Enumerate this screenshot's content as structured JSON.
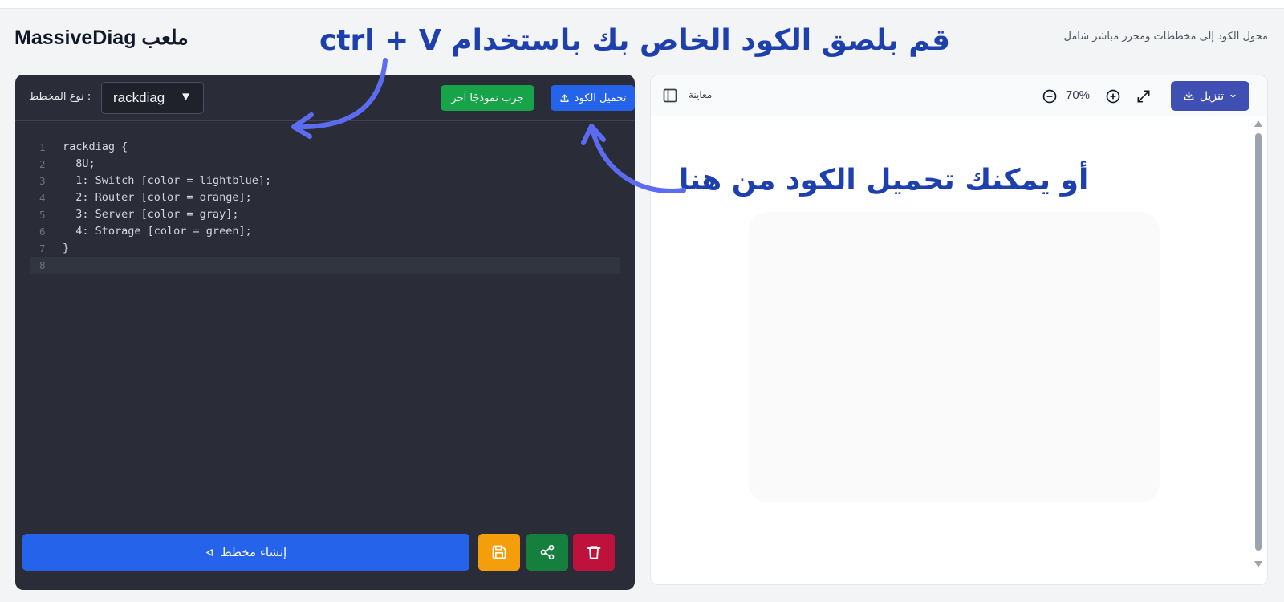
{
  "header": {
    "title": "MassiveDiag ملعب",
    "subtitle": "محول الكود إلى مخططات ومحرر مباشر شامل"
  },
  "annotations": {
    "paste_hint": "قم بلصق الكود الخاص بك باستخدام ctrl + V",
    "upload_hint": "أو يمكنك تحميل الكود من هنا"
  },
  "editor": {
    "type_label": ": نوع المخطط",
    "type_value": "rackdiag",
    "example_button": "جرب نموذجًا آخر",
    "upload_button": "تحميل الكود",
    "code_lines": [
      {
        "n": "1",
        "text": "rackdiag {"
      },
      {
        "n": "2",
        "text": "  8U;"
      },
      {
        "n": "3",
        "text": "  1: Switch [color = lightblue];"
      },
      {
        "n": "4",
        "text": "  2: Router [color = orange];"
      },
      {
        "n": "5",
        "text": "  3: Server [color = gray];"
      },
      {
        "n": "6",
        "text": "  4: Storage [color = green];"
      },
      {
        "n": "7",
        "text": "}"
      },
      {
        "n": "8",
        "text": ""
      }
    ],
    "run_button": "إنشاء مخطط"
  },
  "preview": {
    "label": "معاينة",
    "zoom": "70%",
    "download_button": "تنزيل"
  },
  "colors": {
    "annotation_text": "#1e40af",
    "annotation_arrow": "#5b6cf0",
    "primary": "#2563eb",
    "success": "#16a34a",
    "warning": "#f59e0b",
    "danger": "#be123c",
    "download": "#3f4fb4"
  },
  "icons": {
    "upload": "upload-icon",
    "save": "floppy-disk-icon",
    "share": "share-icon",
    "delete": "trash-icon",
    "run": "play-triangle-icon",
    "download": "download-icon",
    "zoom_in": "zoom-in-icon",
    "zoom_out": "zoom-out-icon",
    "fullscreen": "expand-icon",
    "sidebar": "sidebar-toggle-icon"
  }
}
